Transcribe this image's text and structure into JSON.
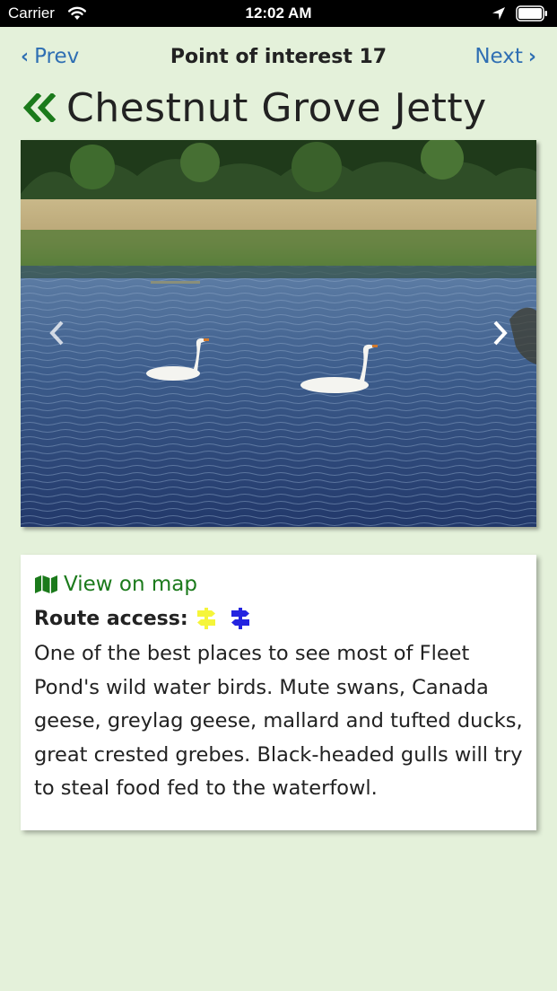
{
  "status_bar": {
    "carrier": "Carrier",
    "time": "12:02 AM",
    "icons": [
      "wifi-icon",
      "location-arrow-icon",
      "battery-icon"
    ]
  },
  "nav": {
    "prev_label": "Prev",
    "next_label": "Next",
    "title": "Point of interest 17"
  },
  "poi": {
    "name": "Chestnut Grove Jetty",
    "back_icon": "double-chevron-left-icon"
  },
  "photo": {
    "subject": "two-swans-on-pond",
    "prev_icon": "chevron-left-icon",
    "next_icon": "chevron-right-icon"
  },
  "card": {
    "map_link_label": "View on map",
    "map_icon": "map-icon",
    "route_access_label": "Route access:",
    "route_signs": [
      {
        "name": "yellow-route-signpost-icon",
        "color": "#f5f53a"
      },
      {
        "name": "blue-route-signpost-icon",
        "color": "#2424e0"
      }
    ],
    "description": "One of the best places to see most of Fleet Pond's wild water birds. Mute swans, Canada geese, greylag geese, mallard and tufted ducks, great crested grebes. Black-headed gulls will try to steal food fed to the waterfowl."
  },
  "colors": {
    "background": "#e4f1da",
    "link_blue": "#2f6fb3",
    "accent_green": "#1b7a1b"
  }
}
